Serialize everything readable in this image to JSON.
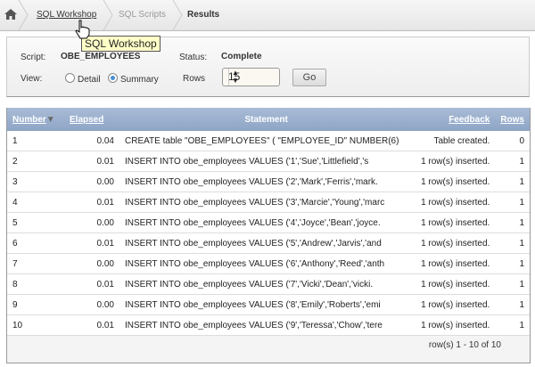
{
  "breadcrumb": {
    "items": [
      "SQL Workshop",
      "SQL Scripts",
      "Results"
    ]
  },
  "tooltip": "SQL Workshop",
  "form": {
    "script_label": "Script:",
    "script_value": "OBE_EMPLOYEES",
    "status_label": "Status:",
    "status_value": "Complete",
    "view_label": "View:",
    "view_options": [
      "Detail",
      "Summary"
    ],
    "view_selected": "Summary",
    "rows_label": "Rows",
    "rows_value": "15",
    "go_label": "Go"
  },
  "table": {
    "headers": {
      "number": "Number",
      "elapsed": "Elapsed",
      "statement": "Statement",
      "feedback": "Feedback",
      "rows": "Rows"
    },
    "rows": [
      [
        "1",
        "0.04",
        "CREATE table \"OBE_EMPLOYEES\" ( \"EMPLOYEE_ID\" NUMBER(6)",
        "Table created.",
        "0"
      ],
      [
        "2",
        "0.01",
        "INSERT INTO obe_employees VALUES ('1','Sue','Littlefield','s",
        "1 row(s) inserted.",
        "1"
      ],
      [
        "3",
        "0.00",
        "INSERT INTO obe_employees VALUES ('2','Mark','Ferris','mark.",
        "1 row(s) inserted.",
        "1"
      ],
      [
        "4",
        "0.01",
        "INSERT INTO obe_employees VALUES ('3','Marcie','Young','marc",
        "1 row(s) inserted.",
        "1"
      ],
      [
        "5",
        "0.00",
        "INSERT INTO obe_employees VALUES ('4','Joyce','Bean','joyce.",
        "1 row(s) inserted.",
        "1"
      ],
      [
        "6",
        "0.01",
        "INSERT INTO obe_employees VALUES ('5','Andrew','Jarvis','and",
        "1 row(s) inserted.",
        "1"
      ],
      [
        "7",
        "0.00",
        "INSERT INTO obe_employees VALUES ('6','Anthony','Reed','anth",
        "1 row(s) inserted.",
        "1"
      ],
      [
        "8",
        "0.01",
        "INSERT INTO obe_employees VALUES ('7','Vicki','Dean','vicki.",
        "1 row(s) inserted.",
        "1"
      ],
      [
        "9",
        "0.00",
        "INSERT INTO obe_employees VALUES ('8','Emily','Roberts','emi",
        "1 row(s) inserted.",
        "1"
      ],
      [
        "10",
        "0.01",
        "INSERT INTO obe_employees VALUES ('9','Teressa','Chow','tere",
        "1 row(s) inserted.",
        "1"
      ]
    ],
    "pagination": "row(s) 1 - 10 of 10"
  }
}
